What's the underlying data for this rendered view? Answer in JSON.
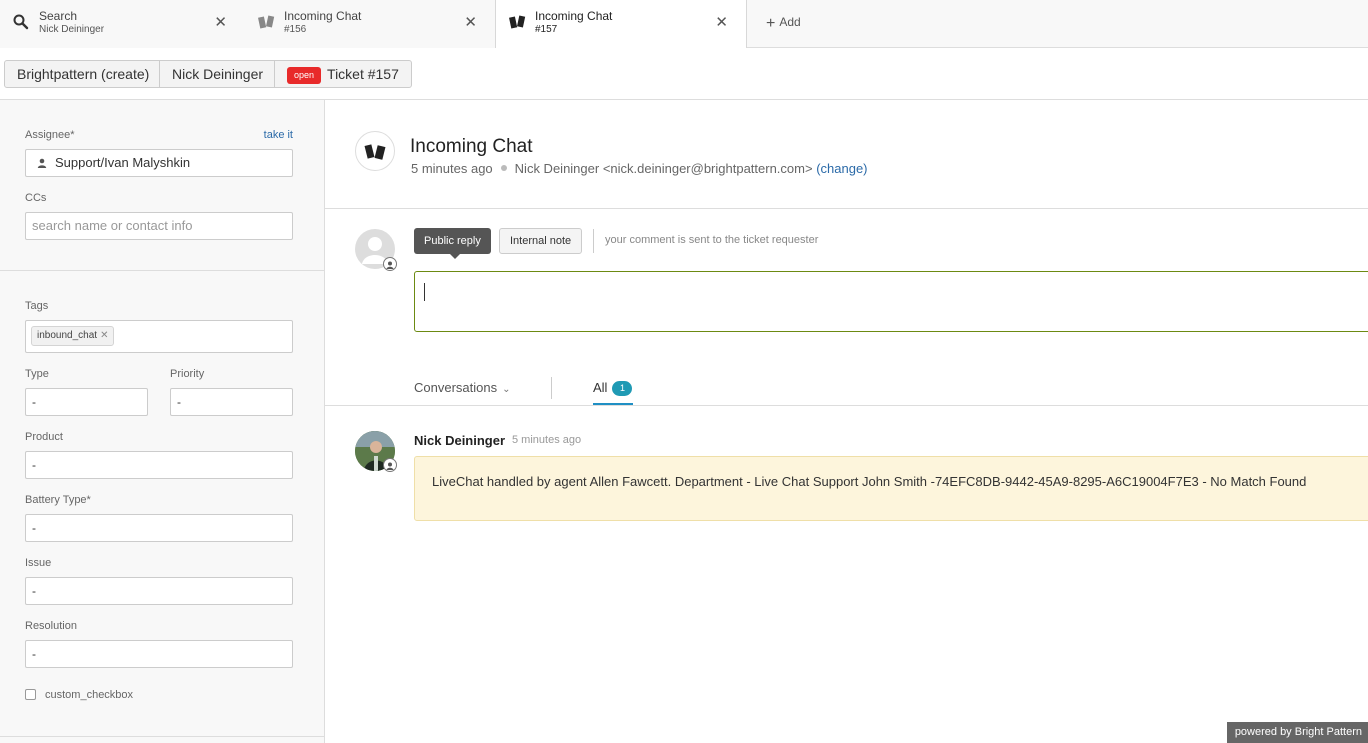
{
  "tabs": [
    {
      "title": "Search",
      "subtitle": "Nick Deininger",
      "icon": "search-icon"
    },
    {
      "title": "Incoming Chat",
      "subtitle": "#156",
      "icon": "zendesk-icon"
    },
    {
      "title": "Incoming Chat",
      "subtitle": "#157",
      "icon": "zendesk-icon",
      "active": true
    }
  ],
  "add_tab_label": "Add",
  "breadcrumb": {
    "org": "Brightpattern (create)",
    "requester": "Nick Deininger",
    "status": "open",
    "ticket": "Ticket #157"
  },
  "sidebar": {
    "assignee_label": "Assignee*",
    "take_it": "take it",
    "assignee_value": "Support/Ivan Malyshkin",
    "ccs_label": "CCs",
    "ccs_placeholder": "search name or contact info",
    "tags_label": "Tags",
    "tags": [
      "inbound_chat"
    ],
    "type_label": "Type",
    "type_value": "-",
    "priority_label": "Priority",
    "priority_value": "-",
    "product_label": "Product",
    "product_value": "-",
    "battery_label": "Battery Type*",
    "battery_value": "-",
    "issue_label": "Issue",
    "issue_value": "-",
    "resolution_label": "Resolution",
    "resolution_value": "-",
    "checkbox_label": "custom_checkbox"
  },
  "ticket": {
    "title": "Incoming Chat",
    "time_ago": "5 minutes ago",
    "requester": "Nick Deininger <nick.deininger@brightpattern.com>",
    "change_link": "(change)"
  },
  "composer": {
    "public_reply": "Public reply",
    "internal_note": "Internal note",
    "hint": "your comment is sent to the ticket requester"
  },
  "filters": {
    "conversations": "Conversations",
    "all": "All",
    "all_count": "1"
  },
  "event": {
    "author": "Nick Deininger",
    "time": "5 minutes ago",
    "body": "LiveChat handled by agent Allen Fawcett. Department - Live Chat Support John Smith -74EFC8DB-9442-45A9-8295-A6C19004F7E3 - No Match Found"
  },
  "footer": {
    "powered_by": "powered by Bright Pattern"
  },
  "colors": {
    "status_open": "#e82a2a",
    "link": "#2b6aa8",
    "accent_tab": "#1f8fc4",
    "comment_border": "#6c8a12",
    "event_bg": "#fdf5dc"
  }
}
